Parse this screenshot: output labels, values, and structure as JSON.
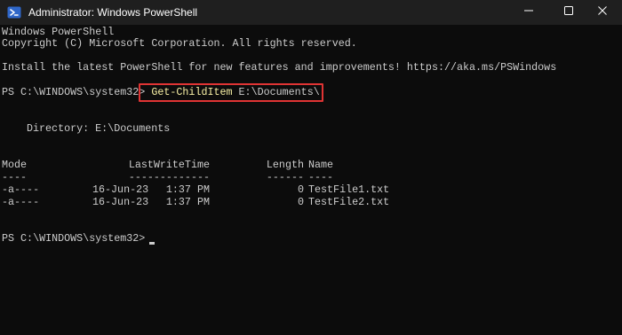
{
  "window": {
    "title": "Administrator: Windows PowerShell",
    "icon": "powershell-icon",
    "controls": {
      "minimize": "minimize-icon",
      "maximize": "maximize-icon",
      "close": "close-icon"
    }
  },
  "console": {
    "lines": [
      "Windows PowerShell",
      "Copyright (C) Microsoft Corporation. All rights reserved.",
      "Install the latest PowerShell for new features and improvements! https://aka.ms/PSWindows"
    ],
    "prompt1": "PS C:\\WINDOWS\\system32>",
    "command_name": "Get-ChildItem",
    "command_arg": "E:\\Documents\\",
    "directory_label": "Directory: E:\\Documents",
    "table": {
      "headers": [
        "Mode",
        "LastWriteTime",
        "Length",
        "Name"
      ],
      "separators": [
        "----",
        "-------------",
        "------",
        "----"
      ],
      "rows": [
        {
          "mode": "-a----",
          "date": "16-Jun-23",
          "time": "1:37 PM",
          "length": "0",
          "name": "TestFile1.txt"
        },
        {
          "mode": "-a----",
          "date": "16-Jun-23",
          "time": "1:37 PM",
          "length": "0",
          "name": "TestFile2.txt"
        }
      ]
    },
    "prompt2": "PS C:\\WINDOWS\\system32>"
  },
  "colors": {
    "console_background": "#0c0c0c",
    "console_text": "#cccccc",
    "command_text": "#f9f1a5",
    "highlight_border": "#e03434",
    "titlebar": "#1f1f1f"
  }
}
